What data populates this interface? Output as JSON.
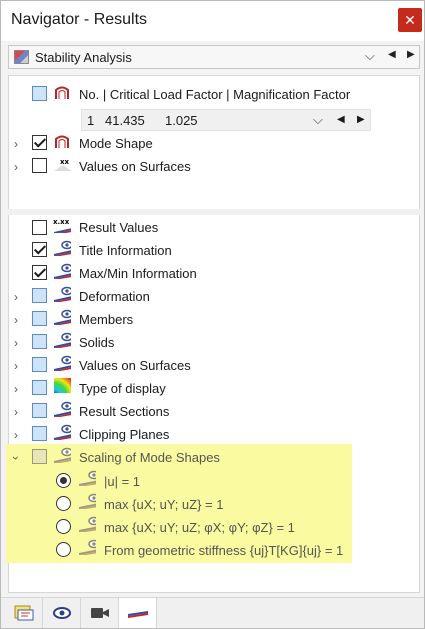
{
  "window": {
    "title": "Navigator - Results",
    "close_label": "✕"
  },
  "combo": {
    "label": "Stability Analysis",
    "chevron": "⌵",
    "prev": "◀",
    "next": "▶"
  },
  "mode_table": {
    "header": "No. | Critical Load Factor | Magnification Factor",
    "no": "1",
    "critical_load_factor": "41.435",
    "magnification_factor": "1.025",
    "chevron": "⌵"
  },
  "top_items": [
    {
      "label": "Mode Shape",
      "checked": true
    },
    {
      "label": "Values on Surfaces",
      "checked": false
    }
  ],
  "items": [
    {
      "label": "Result Values"
    },
    {
      "label": "Title Information"
    },
    {
      "label": "Max/Min Information"
    },
    {
      "label": "Deformation"
    },
    {
      "label": "Members"
    },
    {
      "label": "Solids"
    },
    {
      "label": "Values on Surfaces"
    },
    {
      "label": "Type of display"
    },
    {
      "label": "Result Sections"
    },
    {
      "label": "Clipping Planes"
    },
    {
      "label": "Scaling of Mode Shapes"
    }
  ],
  "scaling_options": [
    {
      "label": "|u| = 1",
      "selected": true
    },
    {
      "label": "max {uX; uY; uZ} = 1",
      "selected": false
    },
    {
      "label": "max {uX; uY; uZ; φX; φY; φZ} = 1",
      "selected": false
    },
    {
      "label": "From geometric stiffness {uj}T[KG]{uj} = 1",
      "selected": false
    }
  ],
  "colors": {
    "highlight": "#fafaa0",
    "close": "#c42b1c",
    "checkbox_blue": "#cfe3f6"
  },
  "tabs": [
    "data-icon",
    "eye-icon",
    "camera-icon",
    "results-icon"
  ]
}
